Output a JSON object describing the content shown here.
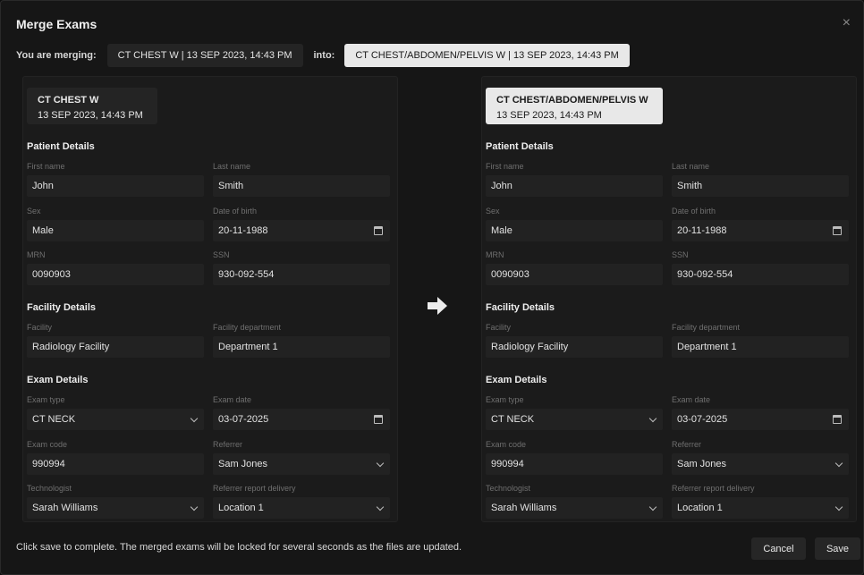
{
  "dialog": {
    "title": "Merge Exams",
    "close_symbol": "×"
  },
  "merge_row": {
    "merging_label": "You are merging:",
    "source_chip": "CT CHEST W | 13 SEP 2023, 14:43 PM",
    "into_label": "into:",
    "target_chip": "CT CHEST/ABDOMEN/PELVIS W | 13 SEP 2023, 14:43 PM"
  },
  "source": {
    "card_name": "CT CHEST W",
    "card_date": "13 SEP 2023, 14:43 PM",
    "patient_title": "Patient Details",
    "first_name_label": "First name",
    "first_name": "John",
    "last_name_label": "Last name",
    "last_name": "Smith",
    "sex_label": "Sex",
    "sex": "Male",
    "dob_label": "Date of birth",
    "dob": "20-11-1988",
    "mrn_label": "MRN",
    "mrn": "0090903",
    "ssn_label": "SSN",
    "ssn": "930-092-554",
    "facility_title": "Facility Details",
    "facility_label": "Facility",
    "facility": "Radiology Facility",
    "facility_dept_label": "Facility department",
    "facility_dept": "Department 1",
    "exam_title": "Exam Details",
    "exam_type_label": "Exam type",
    "exam_type": "CT NECK",
    "exam_date_label": "Exam date",
    "exam_date": "03-07-2025",
    "exam_code_label": "Exam code",
    "exam_code": "990994",
    "referrer_label": "Referrer",
    "referrer": "Sam Jones",
    "technologist_label": "Technologist",
    "technologist": "Sarah Williams",
    "delivery_label": "Referrer report delivery",
    "delivery": "Location 1"
  },
  "target": {
    "card_name": "CT CHEST/ABDOMEN/PELVIS W",
    "card_date": "13 SEP 2023, 14:43 PM",
    "patient_title": "Patient Details",
    "first_name_label": "First name",
    "first_name": "John",
    "last_name_label": "Last name",
    "last_name": "Smith",
    "sex_label": "Sex",
    "sex": "Male",
    "dob_label": "Date of birth",
    "dob": "20-11-1988",
    "mrn_label": "MRN",
    "mrn": "0090903",
    "ssn_label": "SSN",
    "ssn": "930-092-554",
    "facility_title": "Facility Details",
    "facility_label": "Facility",
    "facility": "Radiology Facility",
    "facility_dept_label": "Facility department",
    "facility_dept": "Department 1",
    "exam_title": "Exam Details",
    "exam_type_label": "Exam type",
    "exam_type": "CT NECK",
    "exam_date_label": "Exam date",
    "exam_date": "03-07-2025",
    "exam_code_label": "Exam code",
    "exam_code": "990994",
    "referrer_label": "Referrer",
    "referrer": "Sam Jones",
    "technologist_label": "Technologist",
    "technologist": "Sarah Williams",
    "delivery_label": "Referrer report delivery",
    "delivery": "Location 1"
  },
  "footer": {
    "message": "Click save to complete.  The merged exams will be locked for several seconds as the files are updated.",
    "cancel_label": "Cancel",
    "save_label": "Save"
  },
  "icons": {
    "close": "close-icon",
    "calendar": "calendar-icon",
    "dropdown": "chevron-down-icon",
    "merge_arrow": "arrow-right-icon"
  },
  "colors": {
    "background": "#161616",
    "panel": "#1b1b1b",
    "field": "#222222",
    "selected_chip": "#e8e8e8"
  }
}
